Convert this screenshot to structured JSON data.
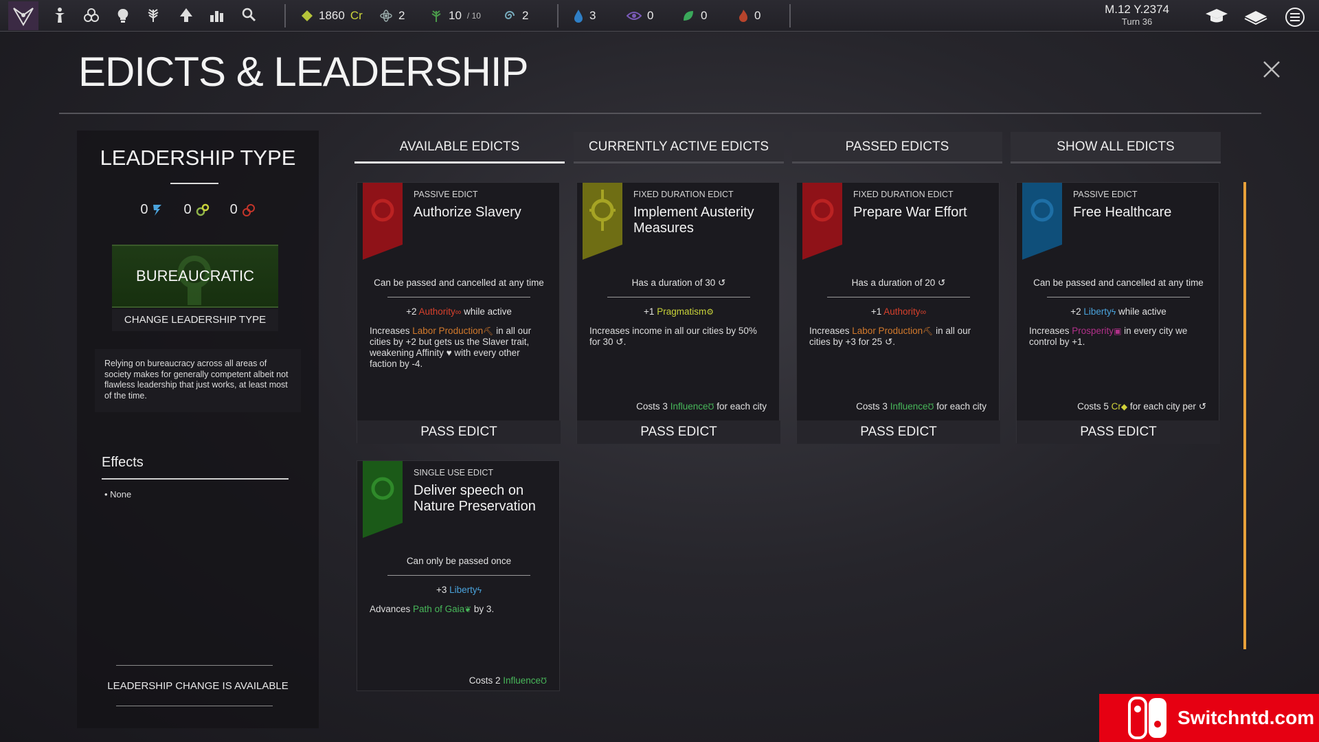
{
  "topbar": {
    "credits": "1860",
    "credits_unit": "Cr",
    "science": "2",
    "population": "10",
    "population_max": "/ 10",
    "spiral": "2",
    "water": "3",
    "eye": "0",
    "leaf": "0",
    "fire": "0",
    "date": "M.12 Y.2374",
    "turn": "Turn 36"
  },
  "page": {
    "title": "EDICTS & LEADERSHIP"
  },
  "leadership": {
    "title": "LEADERSHIP TYPE",
    "stat_liberty": "0",
    "stat_pragmatism": "0",
    "stat_authority": "0",
    "type_name": "BUREAUCRATIC",
    "change_label": "CHANGE LEADERSHIP TYPE",
    "description": "Relying on bureaucracy across all areas of society makes for generally competent albeit not flawless leadership that just works, at least most of the time.",
    "effects_title": "Effects",
    "effects_item": "• None",
    "change_available": "LEADERSHIP CHANGE IS AVAILABLE"
  },
  "tabs": [
    {
      "label": "AVAILABLE EDICTS"
    },
    {
      "label": "CURRENTLY ACTIVE EDICTS"
    },
    {
      "label": "PASSED EDICTS"
    },
    {
      "label": "SHOW ALL EDICTS"
    }
  ],
  "cards": [
    {
      "kind": "PASSIVE EDICT",
      "name": "Authorize Slavery",
      "sub": "Can be passed and cancelled at any time",
      "bonus_pre": "+2 ",
      "bonus_key": "Authority",
      "bonus_post": " while active",
      "effect_pre": "Increases ",
      "effect_key": "Labor Production",
      "effect_post": " in all our cities by +2 but gets us the Slaver trait, weakening Affinity ♥ with every other faction by -4.",
      "cost_pre": "",
      "cost_key": "",
      "cost_post": "",
      "pass": "PASS EDICT",
      "banner_color": "#a2131a"
    },
    {
      "kind": "FIXED DURATION EDICT",
      "name": "Implement Austerity Measures",
      "sub": "Has a duration of 30",
      "bonus_pre": "+1 ",
      "bonus_key": "Pragmatism",
      "bonus_post": "",
      "effect_pre": "Increases income in all our cities by 50% for 30",
      "effect_key": "",
      "effect_post": ".",
      "cost_pre": "Costs 3 ",
      "cost_key": "Influence",
      "cost_post": " for each city",
      "pass": "PASS EDICT",
      "banner_color": "#8f8f1a"
    },
    {
      "kind": "FIXED DURATION EDICT",
      "name": "Prepare War Effort",
      "sub": "Has a duration of 20",
      "bonus_pre": "+1 ",
      "bonus_key": "Authority",
      "bonus_post": "",
      "effect_pre": "Increases ",
      "effect_key": "Labor Production",
      "effect_post": " in all our cities by +3 for 25",
      "cost_pre": "Costs 3 ",
      "cost_key": "Influence",
      "cost_post": " for each city",
      "pass": "PASS EDICT",
      "banner_color": "#a2131a"
    },
    {
      "kind": "PASSIVE EDICT",
      "name": "Free Healthcare",
      "sub": "Can be passed and cancelled at any time",
      "bonus_pre": "+2 ",
      "bonus_key": "Liberty",
      "bonus_post": " while active",
      "effect_pre": "Increases ",
      "effect_key": "Prosperity",
      "effect_post": " in every city we control by +1.",
      "cost_pre": "Costs 5 ",
      "cost_key": "Cr",
      "cost_post": " for each city per",
      "pass": "PASS EDICT",
      "banner_color": "#125a8a"
    },
    {
      "kind": "SINGLE USE EDICT",
      "name": "Deliver speech on Nature Preservation",
      "sub": "Can only be passed once",
      "bonus_pre": "+3 ",
      "bonus_key": "Liberty",
      "bonus_post": "",
      "effect_pre": "Advances ",
      "effect_key": "Path of Gaia",
      "effect_post": " by 3.",
      "cost_pre": "Costs 2 ",
      "cost_key": "Influence",
      "cost_post": "",
      "pass": "",
      "banner_color": "#1f6a1c"
    }
  ],
  "watermark": {
    "text": "Switchntd.com"
  }
}
